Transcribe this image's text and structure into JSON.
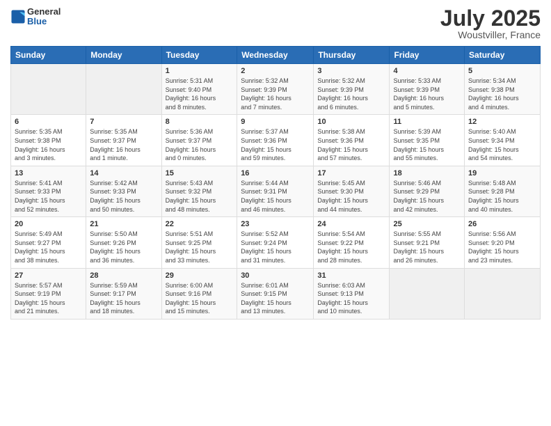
{
  "header": {
    "logo": {
      "general": "General",
      "blue": "Blue"
    },
    "title": "July 2025",
    "location": "Woustviller, France"
  },
  "weekdays": [
    "Sunday",
    "Monday",
    "Tuesday",
    "Wednesday",
    "Thursday",
    "Friday",
    "Saturday"
  ],
  "weeks": [
    [
      {
        "day": "",
        "info": ""
      },
      {
        "day": "",
        "info": ""
      },
      {
        "day": "1",
        "info": "Sunrise: 5:31 AM\nSunset: 9:40 PM\nDaylight: 16 hours\nand 8 minutes."
      },
      {
        "day": "2",
        "info": "Sunrise: 5:32 AM\nSunset: 9:39 PM\nDaylight: 16 hours\nand 7 minutes."
      },
      {
        "day": "3",
        "info": "Sunrise: 5:32 AM\nSunset: 9:39 PM\nDaylight: 16 hours\nand 6 minutes."
      },
      {
        "day": "4",
        "info": "Sunrise: 5:33 AM\nSunset: 9:39 PM\nDaylight: 16 hours\nand 5 minutes."
      },
      {
        "day": "5",
        "info": "Sunrise: 5:34 AM\nSunset: 9:38 PM\nDaylight: 16 hours\nand 4 minutes."
      }
    ],
    [
      {
        "day": "6",
        "info": "Sunrise: 5:35 AM\nSunset: 9:38 PM\nDaylight: 16 hours\nand 3 minutes."
      },
      {
        "day": "7",
        "info": "Sunrise: 5:35 AM\nSunset: 9:37 PM\nDaylight: 16 hours\nand 1 minute."
      },
      {
        "day": "8",
        "info": "Sunrise: 5:36 AM\nSunset: 9:37 PM\nDaylight: 16 hours\nand 0 minutes."
      },
      {
        "day": "9",
        "info": "Sunrise: 5:37 AM\nSunset: 9:36 PM\nDaylight: 15 hours\nand 59 minutes."
      },
      {
        "day": "10",
        "info": "Sunrise: 5:38 AM\nSunset: 9:36 PM\nDaylight: 15 hours\nand 57 minutes."
      },
      {
        "day": "11",
        "info": "Sunrise: 5:39 AM\nSunset: 9:35 PM\nDaylight: 15 hours\nand 55 minutes."
      },
      {
        "day": "12",
        "info": "Sunrise: 5:40 AM\nSunset: 9:34 PM\nDaylight: 15 hours\nand 54 minutes."
      }
    ],
    [
      {
        "day": "13",
        "info": "Sunrise: 5:41 AM\nSunset: 9:33 PM\nDaylight: 15 hours\nand 52 minutes."
      },
      {
        "day": "14",
        "info": "Sunrise: 5:42 AM\nSunset: 9:33 PM\nDaylight: 15 hours\nand 50 minutes."
      },
      {
        "day": "15",
        "info": "Sunrise: 5:43 AM\nSunset: 9:32 PM\nDaylight: 15 hours\nand 48 minutes."
      },
      {
        "day": "16",
        "info": "Sunrise: 5:44 AM\nSunset: 9:31 PM\nDaylight: 15 hours\nand 46 minutes."
      },
      {
        "day": "17",
        "info": "Sunrise: 5:45 AM\nSunset: 9:30 PM\nDaylight: 15 hours\nand 44 minutes."
      },
      {
        "day": "18",
        "info": "Sunrise: 5:46 AM\nSunset: 9:29 PM\nDaylight: 15 hours\nand 42 minutes."
      },
      {
        "day": "19",
        "info": "Sunrise: 5:48 AM\nSunset: 9:28 PM\nDaylight: 15 hours\nand 40 minutes."
      }
    ],
    [
      {
        "day": "20",
        "info": "Sunrise: 5:49 AM\nSunset: 9:27 PM\nDaylight: 15 hours\nand 38 minutes."
      },
      {
        "day": "21",
        "info": "Sunrise: 5:50 AM\nSunset: 9:26 PM\nDaylight: 15 hours\nand 36 minutes."
      },
      {
        "day": "22",
        "info": "Sunrise: 5:51 AM\nSunset: 9:25 PM\nDaylight: 15 hours\nand 33 minutes."
      },
      {
        "day": "23",
        "info": "Sunrise: 5:52 AM\nSunset: 9:24 PM\nDaylight: 15 hours\nand 31 minutes."
      },
      {
        "day": "24",
        "info": "Sunrise: 5:54 AM\nSunset: 9:22 PM\nDaylight: 15 hours\nand 28 minutes."
      },
      {
        "day": "25",
        "info": "Sunrise: 5:55 AM\nSunset: 9:21 PM\nDaylight: 15 hours\nand 26 minutes."
      },
      {
        "day": "26",
        "info": "Sunrise: 5:56 AM\nSunset: 9:20 PM\nDaylight: 15 hours\nand 23 minutes."
      }
    ],
    [
      {
        "day": "27",
        "info": "Sunrise: 5:57 AM\nSunset: 9:19 PM\nDaylight: 15 hours\nand 21 minutes."
      },
      {
        "day": "28",
        "info": "Sunrise: 5:59 AM\nSunset: 9:17 PM\nDaylight: 15 hours\nand 18 minutes."
      },
      {
        "day": "29",
        "info": "Sunrise: 6:00 AM\nSunset: 9:16 PM\nDaylight: 15 hours\nand 15 minutes."
      },
      {
        "day": "30",
        "info": "Sunrise: 6:01 AM\nSunset: 9:15 PM\nDaylight: 15 hours\nand 13 minutes."
      },
      {
        "day": "31",
        "info": "Sunrise: 6:03 AM\nSunset: 9:13 PM\nDaylight: 15 hours\nand 10 minutes."
      },
      {
        "day": "",
        "info": ""
      },
      {
        "day": "",
        "info": ""
      }
    ]
  ]
}
